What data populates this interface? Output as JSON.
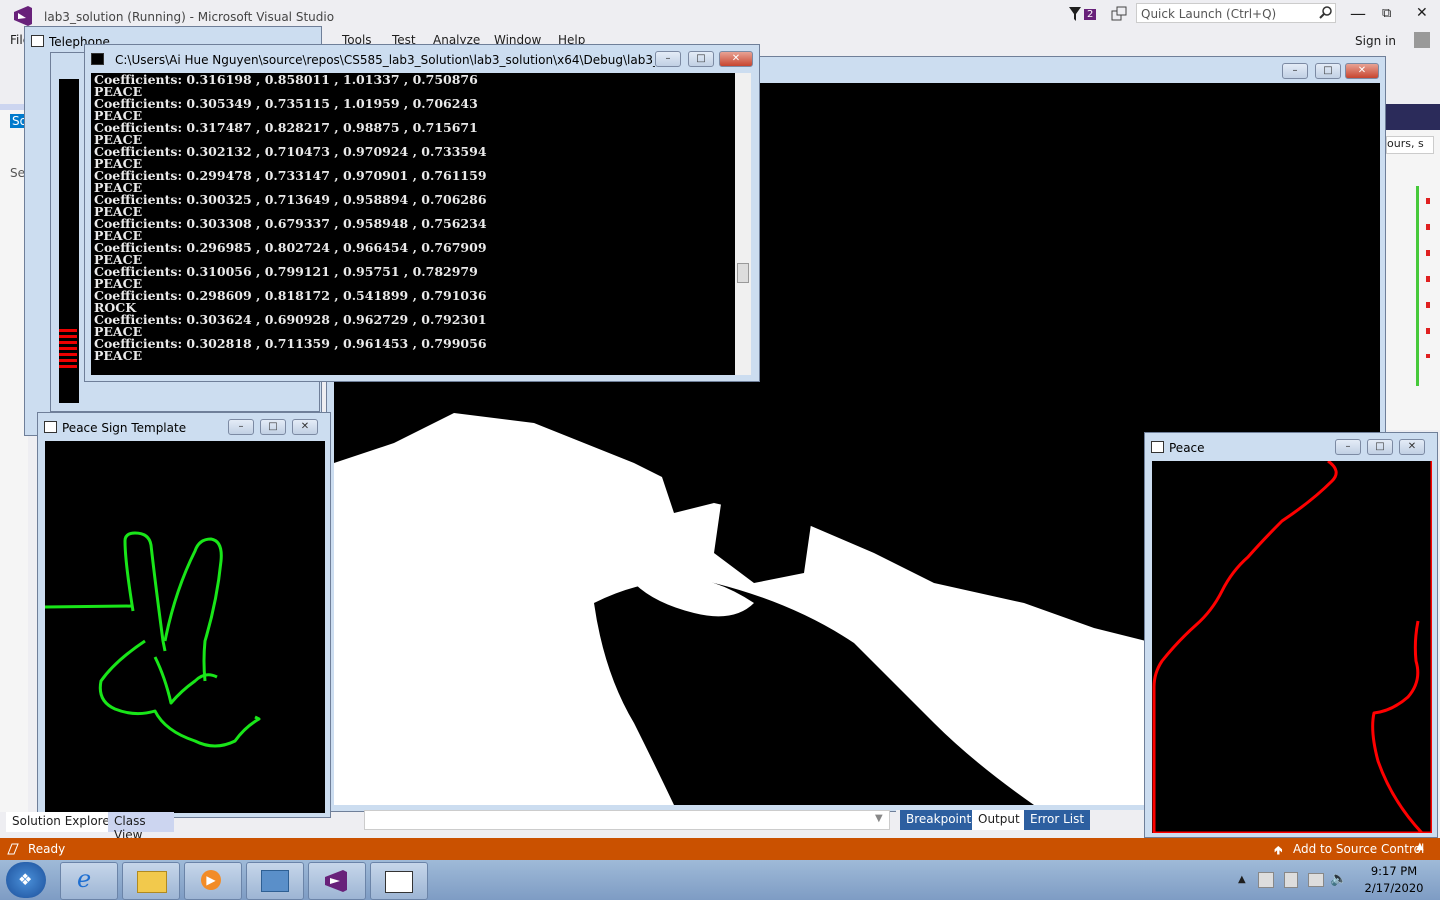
{
  "vs": {
    "title": "lab3_solution (Running) - Microsoft Visual Studio",
    "notification_count": "2",
    "quick_launch_placeholder": "Quick Launch (Ctrl+Q)",
    "sign_in": "Sign in",
    "menu": [
      "File",
      "Tools",
      "Test",
      "Analyze",
      "Window",
      "Help"
    ],
    "telephone_tab": "Telephone",
    "left_tabs": [
      "So",
      "Se"
    ],
    "right_dropdown": "ours, s",
    "bottom_tabs": [
      "Solution Explorer",
      "Class View"
    ],
    "output_tabs": [
      "Breakpoints",
      "Output",
      "Error List"
    ],
    "status": {
      "ready": "Ready",
      "source_control": "Add to Source Control"
    }
  },
  "console": {
    "title": "C:\\Users\\Ai Hue Nguyen\\source\\repos\\CS585_lab3_Solution\\lab3_solution\\x64\\Debug\\lab3_solutio...",
    "lines": [
      "Coefficients: 0.316198 , 0.858011 , 1.01337 , 0.750876",
      "PEACE",
      "Coefficients: 0.305349 , 0.735115 , 1.01959 , 0.706243",
      "PEACE",
      "Coefficients: 0.317487 , 0.828217 , 0.98875 , 0.715671",
      "PEACE",
      "Coefficients: 0.302132 , 0.710473 , 0.970924 , 0.733594",
      "PEACE",
      "Coefficients: 0.299478 , 0.733147 , 0.970901 , 0.761159",
      "PEACE",
      "Coefficients: 0.300325 , 0.713649 , 0.958894 , 0.706286",
      "PEACE",
      "Coefficients: 0.303308 , 0.679337 , 0.958948 , 0.756234",
      "PEACE",
      "Coefficients: 0.296985 , 0.802724 , 0.966454 , 0.767909",
      "PEACE",
      "Coefficients: 0.310056 , 0.799121 , 0.95751 , 0.782979",
      "PEACE",
      "Coefficients: 0.298609 , 0.818172 , 0.541899 , 0.791036",
      "ROCK",
      "Coefficients: 0.303624 , 0.690928 , 0.962729 , 0.792301",
      "PEACE",
      "Coefficients: 0.302818 , 0.711359 , 0.961453 , 0.799056",
      "PEACE"
    ]
  },
  "windows": {
    "template": {
      "title": "Peace Sign Template",
      "contour_color": "#19E619"
    },
    "peace": {
      "title": "Peace",
      "contour_color": "#FF0000"
    }
  },
  "clock": {
    "time": "9:17 PM",
    "date": "2/17/2020"
  }
}
